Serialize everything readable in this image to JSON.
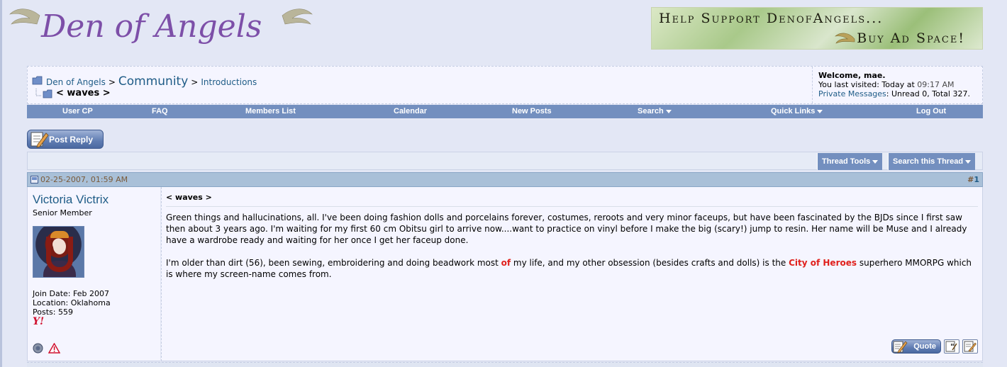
{
  "site": {
    "logo_text": "Den of Angels",
    "ad_line1": "Help Support DenofAngels...",
    "ad_line2": "Buy Ad Space!"
  },
  "breadcrumb": {
    "root": "Den of Angels",
    "separator": ">",
    "community": "Community",
    "forum": "Introductions",
    "thread_title": "< waves >"
  },
  "welcome": {
    "greeting": "Welcome, mae.",
    "last_visited_label": "You last visited: Today at",
    "last_visited_time": "09:17 AM",
    "pm_link": "Private Messages",
    "pm_status": ": Unread 0, Total 327."
  },
  "menu": {
    "items": [
      {
        "label": "User CP",
        "dropdown": false
      },
      {
        "label": "FAQ",
        "dropdown": false
      },
      {
        "label": "Members List",
        "dropdown": false
      },
      {
        "label": "Calendar",
        "dropdown": false
      },
      {
        "label": "New Posts",
        "dropdown": false
      },
      {
        "label": "Search",
        "dropdown": true
      },
      {
        "label": "Quick Links",
        "dropdown": true
      },
      {
        "label": "Log Out",
        "dropdown": false
      }
    ]
  },
  "thread": {
    "post_reply_label": "Post Reply",
    "thread_tools_label": "Thread Tools",
    "search_thread_label": "Search this Thread"
  },
  "post": {
    "date": "02-25-2007, 01:59 AM",
    "number_prefix": "#",
    "number": "1",
    "username": "Victoria Victrix",
    "user_title": "Senior Member",
    "join_date": "Join Date: Feb 2007",
    "location": "Location: Oklahoma",
    "posts": "Posts: 559",
    "title": "< waves >",
    "para1": "Green things and hallucinations, all. I've been doing fashion dolls and porcelains forever, costumes, reroots and very minor faceups, but have been fascinated by the BJDs since I first saw then about 3 years ago. I'm waiting for my first 60 cm Obitsu girl to arrive now....want to practice on vinyl before I make the big (scary!) jump to resin. Her name will be Muse and I already have a wardrobe ready and waiting for her once I get her faceup done.",
    "para2_a": "I'm older than dirt (56), been sewing, embroidering and doing beadwork most ",
    "para2_red1": "of",
    "para2_b": " my life, and my other obsession (besides crafts and dolls) is the ",
    "para2_red2": "City of Heroes",
    "para2_c": " superhero MMORPG which is where my screen-name comes from.",
    "quote_label": "Quote"
  },
  "colors": {
    "menu_bar": "#738fbf",
    "link": "#1f5c87",
    "highlight_red": "#e0201c",
    "post_header": "#a9c0d8"
  }
}
